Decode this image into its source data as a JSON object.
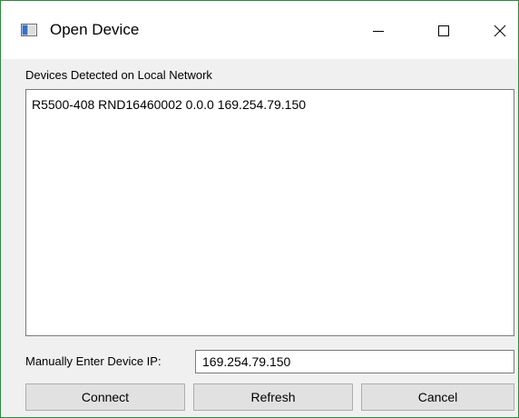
{
  "window": {
    "title": "Open Device",
    "title_icon": "app-window-icon",
    "controls": {
      "minimize_icon": "minimize-icon",
      "maximize_icon": "maximize-icon",
      "close_icon": "close-icon"
    }
  },
  "devices": {
    "label": "Devices Detected on Local Network",
    "items": [
      {
        "text": "R5500-408 RND16460002 0.0.0 169.254.79.150"
      }
    ]
  },
  "manual_ip": {
    "label": "Manually Enter Device IP:",
    "value": "169.254.79.150"
  },
  "buttons": {
    "connect": "Connect",
    "refresh": "Refresh",
    "cancel": "Cancel"
  },
  "colors": {
    "window_border": "#2b8a3e",
    "dialog_background": "#f0f0f0",
    "button_background": "#e1e1e1"
  }
}
